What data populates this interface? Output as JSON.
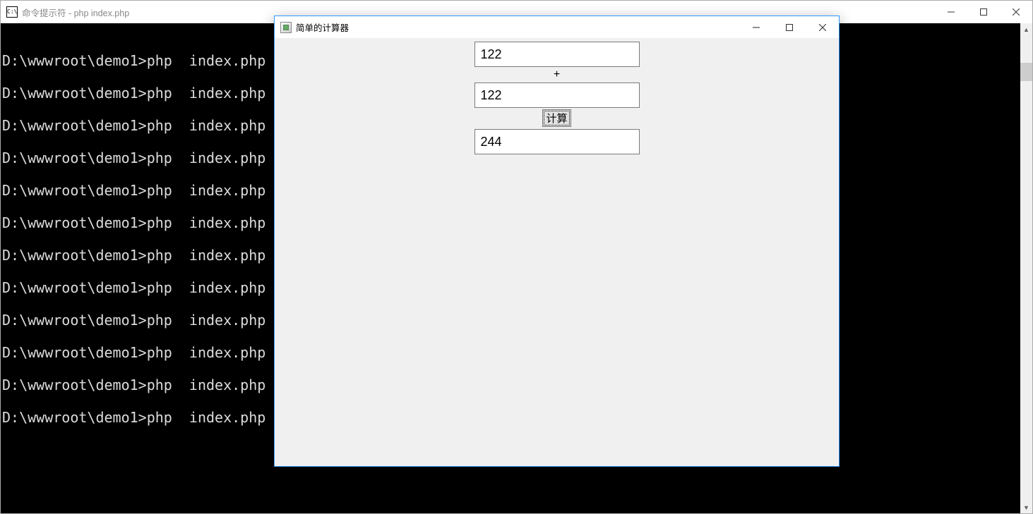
{
  "cmd": {
    "title": "命令提示符 - php  index.php",
    "lines": [
      "D:\\wwwroot\\demo1>php  index.php",
      "D:\\wwwroot\\demo1>php  index.php",
      "D:\\wwwroot\\demo1>php  index.php",
      "D:\\wwwroot\\demo1>php  index.php",
      "D:\\wwwroot\\demo1>php  index.php",
      "D:\\wwwroot\\demo1>php  index.php",
      "D:\\wwwroot\\demo1>php  index.php",
      "D:\\wwwroot\\demo1>php  index.php",
      "D:\\wwwroot\\demo1>php  index.php",
      "D:\\wwwroot\\demo1>php  index.php",
      "D:\\wwwroot\\demo1>php  index.php",
      "D:\\wwwroot\\demo1>php  index.php"
    ],
    "icon_text": "C:\\"
  },
  "calc": {
    "title": "简单的计算器",
    "input1": "122",
    "operator": "+",
    "input2": "122",
    "button_label": "计算",
    "result": "244"
  }
}
